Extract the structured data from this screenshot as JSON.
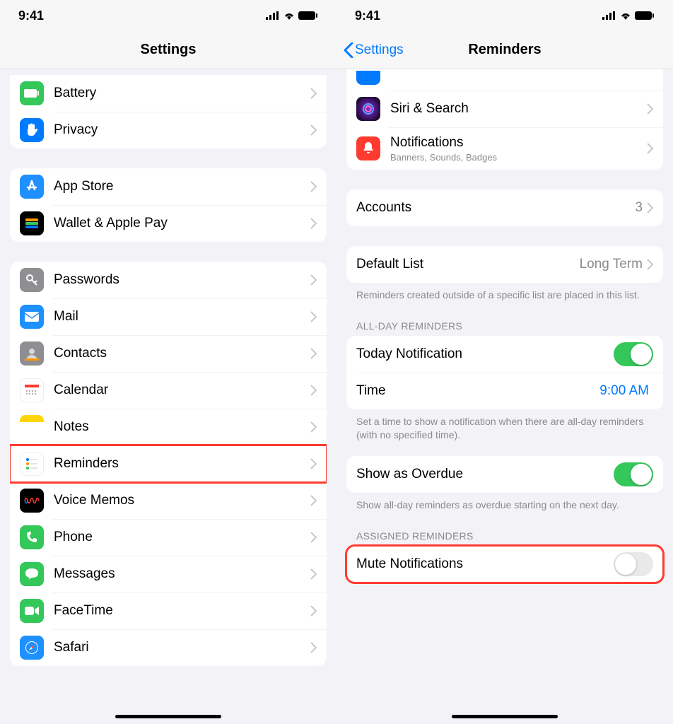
{
  "status": {
    "time": "9:41"
  },
  "left": {
    "title": "Settings",
    "group1": [
      {
        "id": "battery",
        "label": "Battery"
      },
      {
        "id": "privacy",
        "label": "Privacy"
      }
    ],
    "group2": [
      {
        "id": "appstore",
        "label": "App Store"
      },
      {
        "id": "wallet",
        "label": "Wallet & Apple Pay"
      }
    ],
    "group3": [
      {
        "id": "passwords",
        "label": "Passwords"
      },
      {
        "id": "mail",
        "label": "Mail"
      },
      {
        "id": "contacts",
        "label": "Contacts"
      },
      {
        "id": "calendar",
        "label": "Calendar"
      },
      {
        "id": "notes",
        "label": "Notes"
      },
      {
        "id": "reminders",
        "label": "Reminders",
        "highlight": true
      },
      {
        "id": "voicememos",
        "label": "Voice Memos"
      },
      {
        "id": "phone",
        "label": "Phone"
      },
      {
        "id": "messages",
        "label": "Messages"
      },
      {
        "id": "facetime",
        "label": "FaceTime"
      },
      {
        "id": "safari",
        "label": "Safari"
      }
    ]
  },
  "right": {
    "back": "Settings",
    "title": "Reminders",
    "top": {
      "siri": "Siri & Search",
      "notifications": "Notifications",
      "notifications_sub": "Banners, Sounds, Badges"
    },
    "accounts": {
      "label": "Accounts",
      "value": "3"
    },
    "default_list": {
      "label": "Default List",
      "value": "Long Term"
    },
    "default_list_footer": "Reminders created outside of a specific list are placed in this list.",
    "allday_header": "ALL-DAY REMINDERS",
    "today_notification": {
      "label": "Today Notification",
      "on": true
    },
    "time": {
      "label": "Time",
      "value": "9:00 AM"
    },
    "allday_footer": "Set a time to show a notification when there are all-day reminders (with no specified time).",
    "overdue": {
      "label": "Show as Overdue",
      "on": true
    },
    "overdue_footer": "Show all-day reminders as overdue starting on the next day.",
    "assigned_header": "ASSIGNED REMINDERS",
    "mute": {
      "label": "Mute Notifications",
      "on": false
    }
  }
}
